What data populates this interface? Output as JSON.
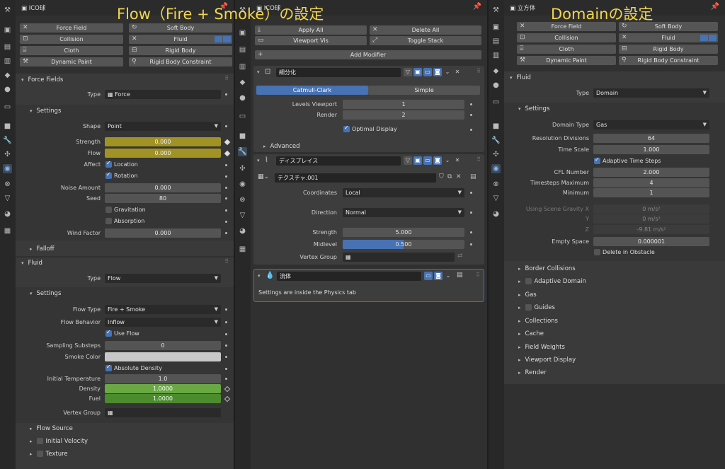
{
  "overlays": {
    "flow": "Flow（Fire + Smoke）の設定",
    "domain": "Domainの設定"
  },
  "left": {
    "object_name": "ICO球",
    "physics_buttons": [
      {
        "label": "Force Field",
        "icon": "close-icon"
      },
      {
        "label": "Soft Body",
        "icon": "soft-body-icon"
      },
      {
        "label": "Collision",
        "icon": "collision-icon"
      },
      {
        "label": "Fluid",
        "icon": "close-icon"
      },
      {
        "label": "Cloth",
        "icon": "cloth-icon"
      },
      {
        "label": "Rigid Body",
        "icon": "rigid-body-icon"
      },
      {
        "label": "Dynamic Paint",
        "icon": "dynamic-paint-icon"
      },
      {
        "label": "Rigid Body Constraint",
        "icon": "constraint-icon"
      }
    ],
    "force_fields": {
      "title": "Force Fields",
      "type_label": "Type",
      "type_value": "Force",
      "settings_title": "Settings",
      "shape_label": "Shape",
      "shape_value": "Point",
      "strength_label": "Strength",
      "strength_value": "0.000",
      "flow_label": "Flow",
      "flow_value": "0.000",
      "affect_label": "Affect",
      "location_label": "Location",
      "rotation_label": "Rotation",
      "noise_label": "Noise Amount",
      "noise_value": "0.000",
      "seed_label": "Seed",
      "seed_value": "80",
      "gravitation_label": "Gravitation",
      "absorption_label": "Absorption",
      "wind_label": "Wind Factor",
      "wind_value": "0.000",
      "falloff_title": "Falloff"
    },
    "fluid": {
      "title": "Fluid",
      "type_label": "Type",
      "type_value": "Flow",
      "settings_title": "Settings",
      "flow_type_label": "Flow Type",
      "flow_type_value": "Fire + Smoke",
      "flow_behavior_label": "Flow Behavior",
      "flow_behavior_value": "Inflow",
      "use_flow_label": "Use Flow",
      "substeps_label": "Sampling Substeps",
      "substeps_value": "0",
      "smoke_color_label": "Smoke Color",
      "absolute_density_label": "Absolute Density",
      "initial_temp_label": "Initial Temperature",
      "initial_temp_value": "1.0",
      "density_label": "Density",
      "density_value": "1.0000",
      "fuel_label": "Fuel",
      "fuel_value": "1.0000",
      "vertex_group_label": "Vertex Group",
      "flow_source_title": "Flow Source",
      "initial_velocity_title": "Initial Velocity",
      "texture_title": "Texture"
    }
  },
  "middle": {
    "object_name": "ICO球",
    "apply_all": "Apply All",
    "delete_all": "Delete All",
    "viewport_vis": "Viewport Vis",
    "toggle_stack": "Toggle Stack",
    "add_modifier": "Add Modifier",
    "subsurf": {
      "name": "細分化",
      "catmull": "Catmull-Clark",
      "simple": "Simple",
      "levels_label": "Levels Viewport",
      "levels_value": "1",
      "render_label": "Render",
      "render_value": "2",
      "optimal_label": "Optimal Display",
      "advanced_title": "Advanced"
    },
    "displace": {
      "name": "ディスプレイス",
      "texture_name": "テクスチャ.001",
      "coords_label": "Coordinates",
      "coords_value": "Local",
      "direction_label": "Direction",
      "direction_value": "Normal",
      "strength_label": "Strength",
      "strength_value": "5.000",
      "midlevel_label": "Midlevel",
      "midlevel_value": "0.500",
      "vgroup_label": "Vertex Group"
    },
    "fluid_mod": {
      "name": "流体",
      "note": "Settings are inside the Physics tab"
    }
  },
  "right": {
    "object_name": "立方体",
    "physics_buttons": [
      {
        "label": "Force Field"
      },
      {
        "label": "Soft Body"
      },
      {
        "label": "Collision"
      },
      {
        "label": "Fluid"
      },
      {
        "label": "Cloth"
      },
      {
        "label": "Rigid Body"
      },
      {
        "label": "Dynamic Paint"
      },
      {
        "label": "Rigid Body Constraint"
      }
    ],
    "fluid": {
      "title": "Fluid",
      "type_label": "Type",
      "type_value": "Domain",
      "settings_title": "Settings",
      "domain_type_label": "Domain Type",
      "domain_type_value": "Gas",
      "res_label": "Resolution Divisions",
      "res_value": "64",
      "timescale_label": "Time Scale",
      "timescale_value": "1.000",
      "adaptive_label": "Adaptive Time Steps",
      "cfl_label": "CFL Number",
      "cfl_value": "2.000",
      "tsmax_label": "Timesteps Maximum",
      "tsmax_value": "4",
      "tsmin_label": "Minimum",
      "tsmin_value": "1",
      "gravity_x_label": "Using Scene Gravity X",
      "gravity_x_value": "0 m/s²",
      "gravity_y_label": "Y",
      "gravity_y_value": "0 m/s²",
      "gravity_z_label": "Z",
      "gravity_z_value": "-9.81 m/s²",
      "empty_space_label": "Empty Space",
      "empty_space_value": "0.000001",
      "delete_obstacle_label": "Delete in Obstacle",
      "subpanels": [
        "Border Collisions",
        "Adaptive Domain",
        "Gas",
        "Guides",
        "Collections",
        "Cache",
        "Field Weights",
        "Viewport Display",
        "Render"
      ]
    }
  }
}
